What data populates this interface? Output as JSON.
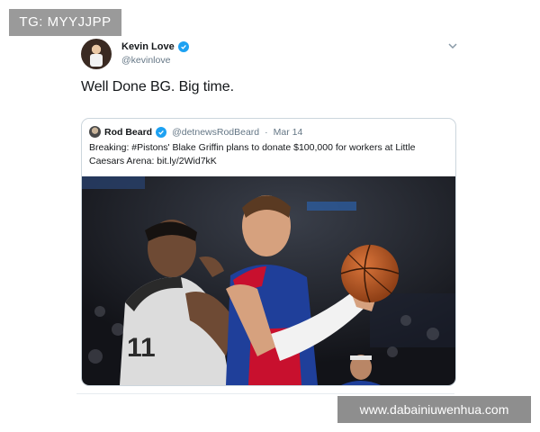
{
  "watermarks": {
    "top": "TG: MYYJJPP",
    "bottom": "www.dabainiuwenhua.com"
  },
  "tweet": {
    "display_name": "Kevin Love",
    "handle": "@kevinlove",
    "text": "Well Done BG. Big time.",
    "icons": [
      "avatar",
      "verified-badge-icon",
      "chevron-down-icon"
    ]
  },
  "quoted_tweet": {
    "display_name": "Rod Beard",
    "handle": "@detnewsRodBeard",
    "separator": "·",
    "date": "Mar 14",
    "text": "Breaking: #Pistons' Blake Griffin plans to donate $100,000 for workers at Little Caesars Arena: bit.ly/2Wid7kK",
    "image_jersey_text": "11"
  },
  "colors": {
    "verified": "#1da1f2",
    "secondary_text": "#657786",
    "border": "#ccd6dd"
  }
}
